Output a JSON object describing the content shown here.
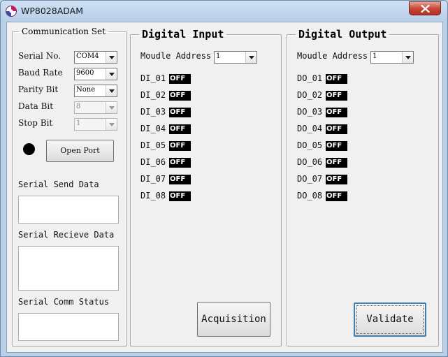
{
  "window": {
    "title": "WP8028ADAM",
    "close_glyph": "✕",
    "app_icon": "app-logo-icon"
  },
  "comm": {
    "legend": "Communication Set",
    "serial_no": {
      "label": "Serial No.",
      "value": "COM4"
    },
    "baud_rate": {
      "label": "Baud Rate",
      "value": "9600"
    },
    "parity_bit": {
      "label": "Parity Bit",
      "value": "None"
    },
    "data_bit": {
      "label": "Data Bit",
      "value": "8"
    },
    "stop_bit": {
      "label": "Stop Bit",
      "value": "1"
    },
    "open_port": "Open Port",
    "send_label": "Serial Send Data",
    "send_value": "",
    "recv_label": "Serial Recieve Data",
    "recv_value": "",
    "status_label": "Serial Comm Status",
    "status_value": ""
  },
  "di": {
    "legend": "Digital Input",
    "address_label": "Moudle Address",
    "address_value": "1",
    "channels": [
      {
        "label": "DI_01",
        "state": "OFF"
      },
      {
        "label": "DI_02",
        "state": "OFF"
      },
      {
        "label": "DI_03",
        "state": "OFF"
      },
      {
        "label": "DI_04",
        "state": "OFF"
      },
      {
        "label": "DI_05",
        "state": "OFF"
      },
      {
        "label": "DI_06",
        "state": "OFF"
      },
      {
        "label": "DI_07",
        "state": "OFF"
      },
      {
        "label": "DI_08",
        "state": "OFF"
      }
    ],
    "button": "Acquisition"
  },
  "do": {
    "legend": "Digital Output",
    "address_label": "Moudle Address",
    "address_value": "1",
    "channels": [
      {
        "label": "DO_01",
        "state": "OFF"
      },
      {
        "label": "DO_02",
        "state": "OFF"
      },
      {
        "label": "DO_03",
        "state": "OFF"
      },
      {
        "label": "DO_04",
        "state": "OFF"
      },
      {
        "label": "DO_05",
        "state": "OFF"
      },
      {
        "label": "DO_06",
        "state": "OFF"
      },
      {
        "label": "DO_07",
        "state": "OFF"
      },
      {
        "label": "DO_08",
        "state": "OFF"
      }
    ],
    "button": "Validate"
  },
  "colors": {
    "close": "#c7483a",
    "indicator": "#000000",
    "focus": "#3c7fb1"
  }
}
